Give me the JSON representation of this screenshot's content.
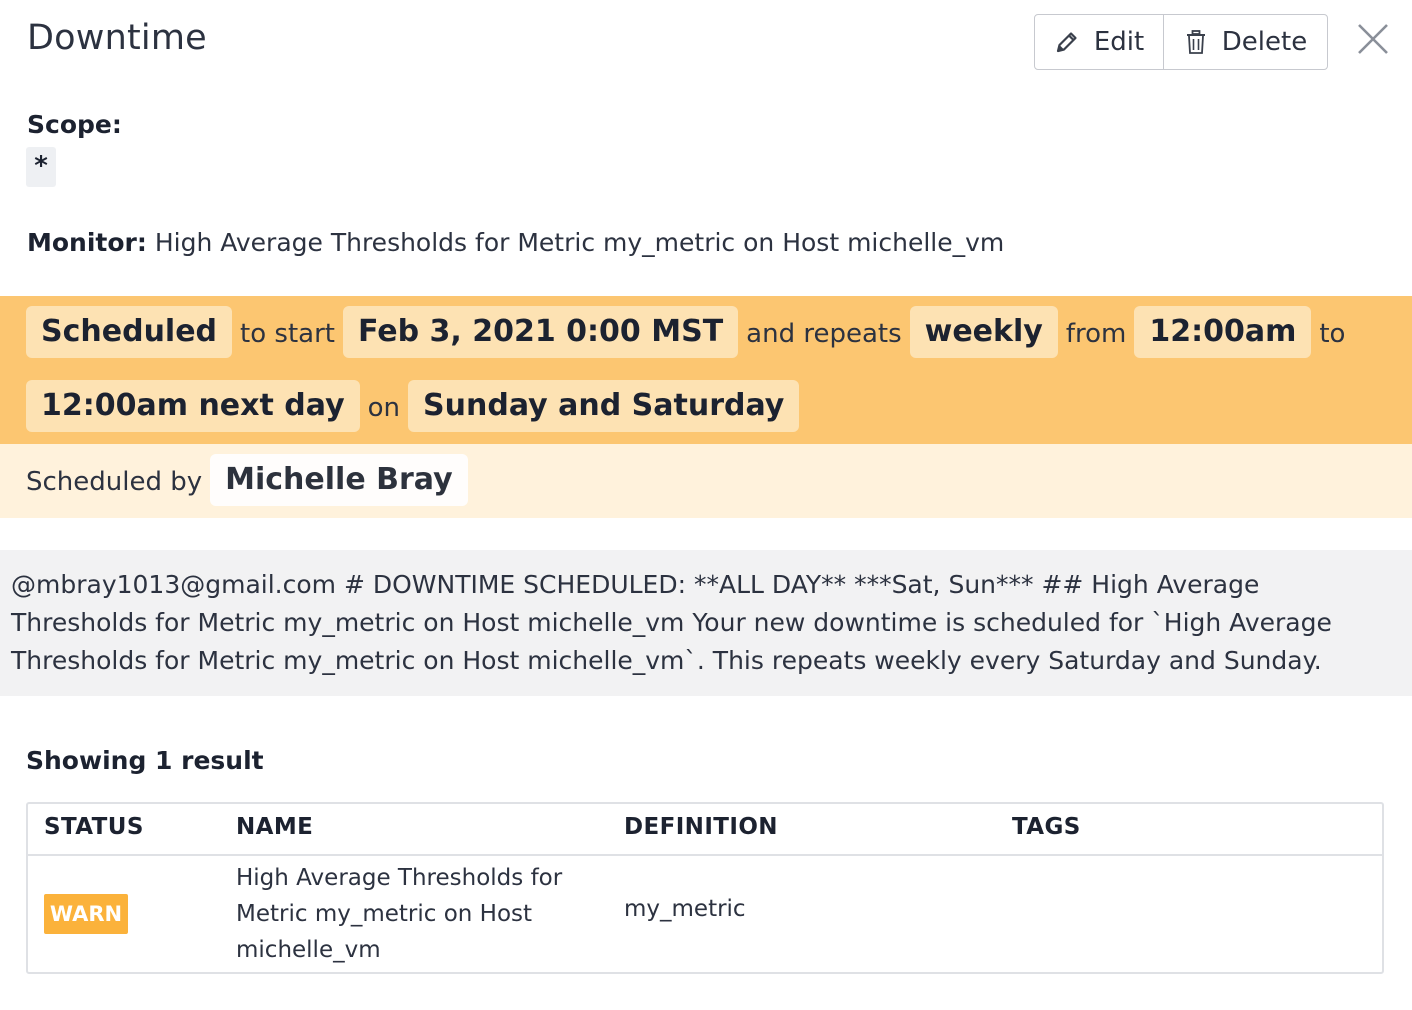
{
  "header": {
    "title": "Downtime",
    "edit_label": "Edit",
    "delete_label": "Delete",
    "edit_icon": "pencil-icon",
    "delete_icon": "trash-icon",
    "close_icon": "close-icon"
  },
  "scope": {
    "label": "Scope:",
    "value": "*"
  },
  "monitor": {
    "label": "Monitor:",
    "value": "High Average Thresholds for Metric my_metric on Host michelle_vm"
  },
  "schedule": {
    "status": "Scheduled",
    "to_start": "to start",
    "start": "Feb 3, 2021 0:00 MST",
    "and_repeats": "and repeats",
    "frequency": "weekly",
    "from": "from",
    "from_time": "12:00am",
    "to": "to",
    "to_time": "12:00am next day",
    "on": "on",
    "days": "Sunday and Saturday",
    "scheduled_by_label": "Scheduled by",
    "scheduled_by": "Michelle Bray",
    "colors": {
      "band": "#fcc671",
      "chip": "#fde2b3",
      "band_light": "#fff2dc"
    }
  },
  "message": "@mbray1013@gmail.com # DOWNTIME SCHEDULED: **ALL DAY** ***Sat, Sun*** ## High Average Thresholds for Metric my_metric on Host michelle_vm Your new downtime is scheduled for `High Average Thresholds for Metric my_metric on Host michelle_vm`. This repeats weekly every Saturday and Sunday.",
  "results": {
    "summary": "Showing 1 result",
    "columns": [
      "STATUS",
      "NAME",
      "DEFINITION",
      "TAGS"
    ],
    "rows": [
      {
        "status": "WARN",
        "name_lines": [
          "High Average Thresholds for",
          "Metric my_metric on Host",
          "michelle_vm"
        ],
        "definition": "my_metric",
        "tags": ""
      }
    ],
    "status_color": "#fbb23b"
  }
}
